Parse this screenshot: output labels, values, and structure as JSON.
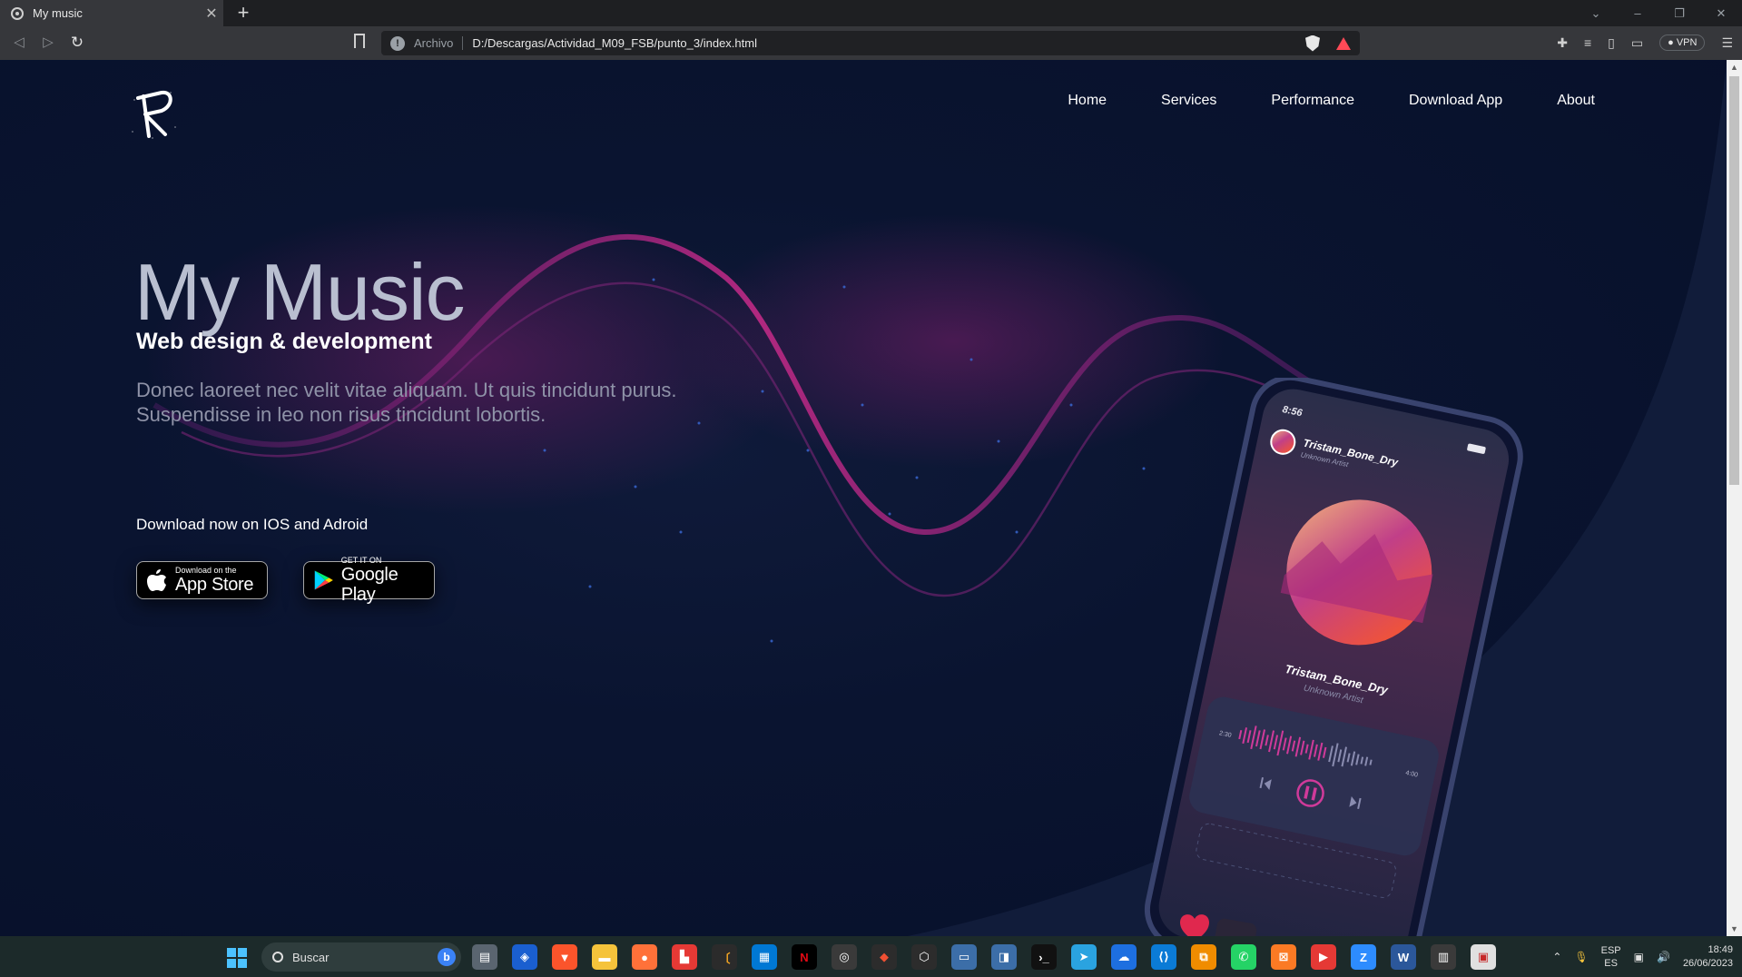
{
  "browser": {
    "tab_title": "My music",
    "tab_close": "✕",
    "new_tab": "+",
    "address_scheme": "Archivo",
    "address_url": "D:/Descargas/Actividad_M09_FSB/punto_3/index.html",
    "vpn_label": "VPN",
    "window_controls": [
      "⌄",
      "–",
      "❐",
      "✕"
    ]
  },
  "site": {
    "nav": [
      "Home",
      "Services",
      "Performance",
      "Download App",
      "About"
    ],
    "hero": {
      "title": "My Music",
      "subtitle": "Web design & development",
      "text_line1": "Donec laoreet nec velit vitae aliquam. Ut quis tincidunt purus.",
      "text_line2": "Suspendisse in leo non risus tincidunt lobortis.",
      "download_text": "Download now on IOS and Adroid"
    },
    "stores": {
      "appstore_small": "Download on the",
      "appstore_big": "App Store",
      "google_small": "GET IT ON",
      "google_big": "Google Play"
    },
    "phone": {
      "time": "8:56",
      "track": "Tristam_Bone_Dry",
      "artist": "Unknown Artist",
      "elapsed": "2:30",
      "duration": "4:00"
    }
  },
  "taskbar": {
    "search_label": "Buscar",
    "lang_line1": "ESP",
    "lang_line2": "ES",
    "time": "18:49",
    "date": "26/06/2023"
  },
  "colors": {
    "page_bg": "#07102a",
    "accent_wave": "#b0287f",
    "hero_title": "#b9bfd0"
  }
}
